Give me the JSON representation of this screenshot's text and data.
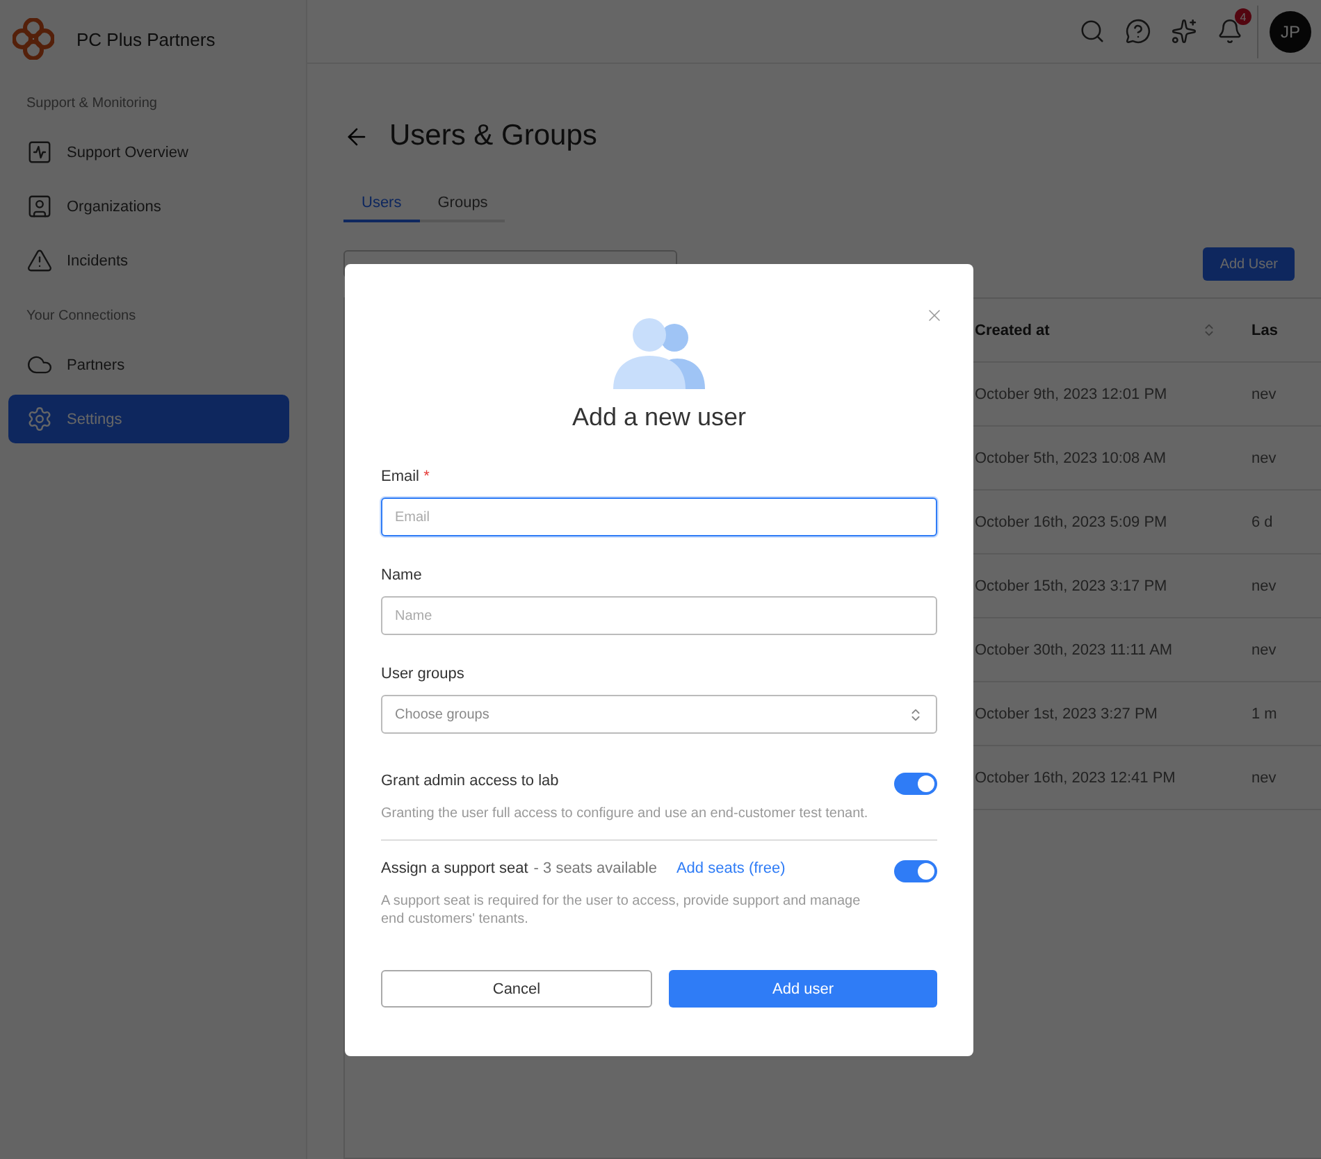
{
  "app": {
    "name": "PC Plus Partners"
  },
  "sidebar": {
    "sections": [
      {
        "title": "Support & Monitoring",
        "items": [
          {
            "label": "Support Overview",
            "kind": "pulse",
            "selected": false
          },
          {
            "label": "Organizations",
            "kind": "person",
            "selected": false
          },
          {
            "label": "Incidents",
            "kind": "warning",
            "selected": false
          }
        ]
      },
      {
        "title": "Your Connections",
        "items": [
          {
            "label": "Partners",
            "kind": "cloud",
            "selected": false
          },
          {
            "label": "Settings",
            "kind": "gear",
            "selected": true
          }
        ]
      }
    ]
  },
  "header": {
    "notification_count": "4",
    "avatar": "JP"
  },
  "page": {
    "title": "Users & Groups",
    "tabs": [
      {
        "label": "Users",
        "selected": true
      },
      {
        "label": "Groups",
        "selected": false
      }
    ],
    "add_button": "Add User",
    "table": {
      "columns": [
        "Created at",
        "Las"
      ],
      "rows": [
        [
          "October 9th, 2023 12:01 PM",
          "nev"
        ],
        [
          "October 5th, 2023 10:08 AM",
          "nev"
        ],
        [
          "October 16th, 2023 5:09 PM",
          "6 d"
        ],
        [
          "October 15th, 2023 3:17 PM",
          "nev"
        ],
        [
          "October 30th, 2023 11:11 AM",
          "nev"
        ],
        [
          "October 1st, 2023 3:27 PM",
          "1 m"
        ],
        [
          "October 16th, 2023 12:41 PM",
          "nev"
        ]
      ]
    }
  },
  "modal": {
    "title": "Add a new user",
    "fields": [
      {
        "label": "Email",
        "required_mark": "*",
        "kind": "text",
        "placeholder": "Email",
        "focused": true
      },
      {
        "label": "Name",
        "kind": "text",
        "placeholder": "Name",
        "focused": false
      },
      {
        "label": "User groups",
        "kind": "select",
        "placeholder": "Choose groups"
      }
    ],
    "toggles": [
      {
        "label": "Grant admin access to lab",
        "description": "Granting the user full access to configure and use an end-customer test tenant.",
        "on": true
      },
      {
        "label": "Assign a support seat",
        "note": "- 3 seats available",
        "link": "Add seats (free)",
        "description": "A support seat is required for the user to access, provide support and manage end customers' tenants.",
        "on": true
      }
    ],
    "buttons": {
      "cancel": "Cancel",
      "submit": "Add user"
    }
  }
}
